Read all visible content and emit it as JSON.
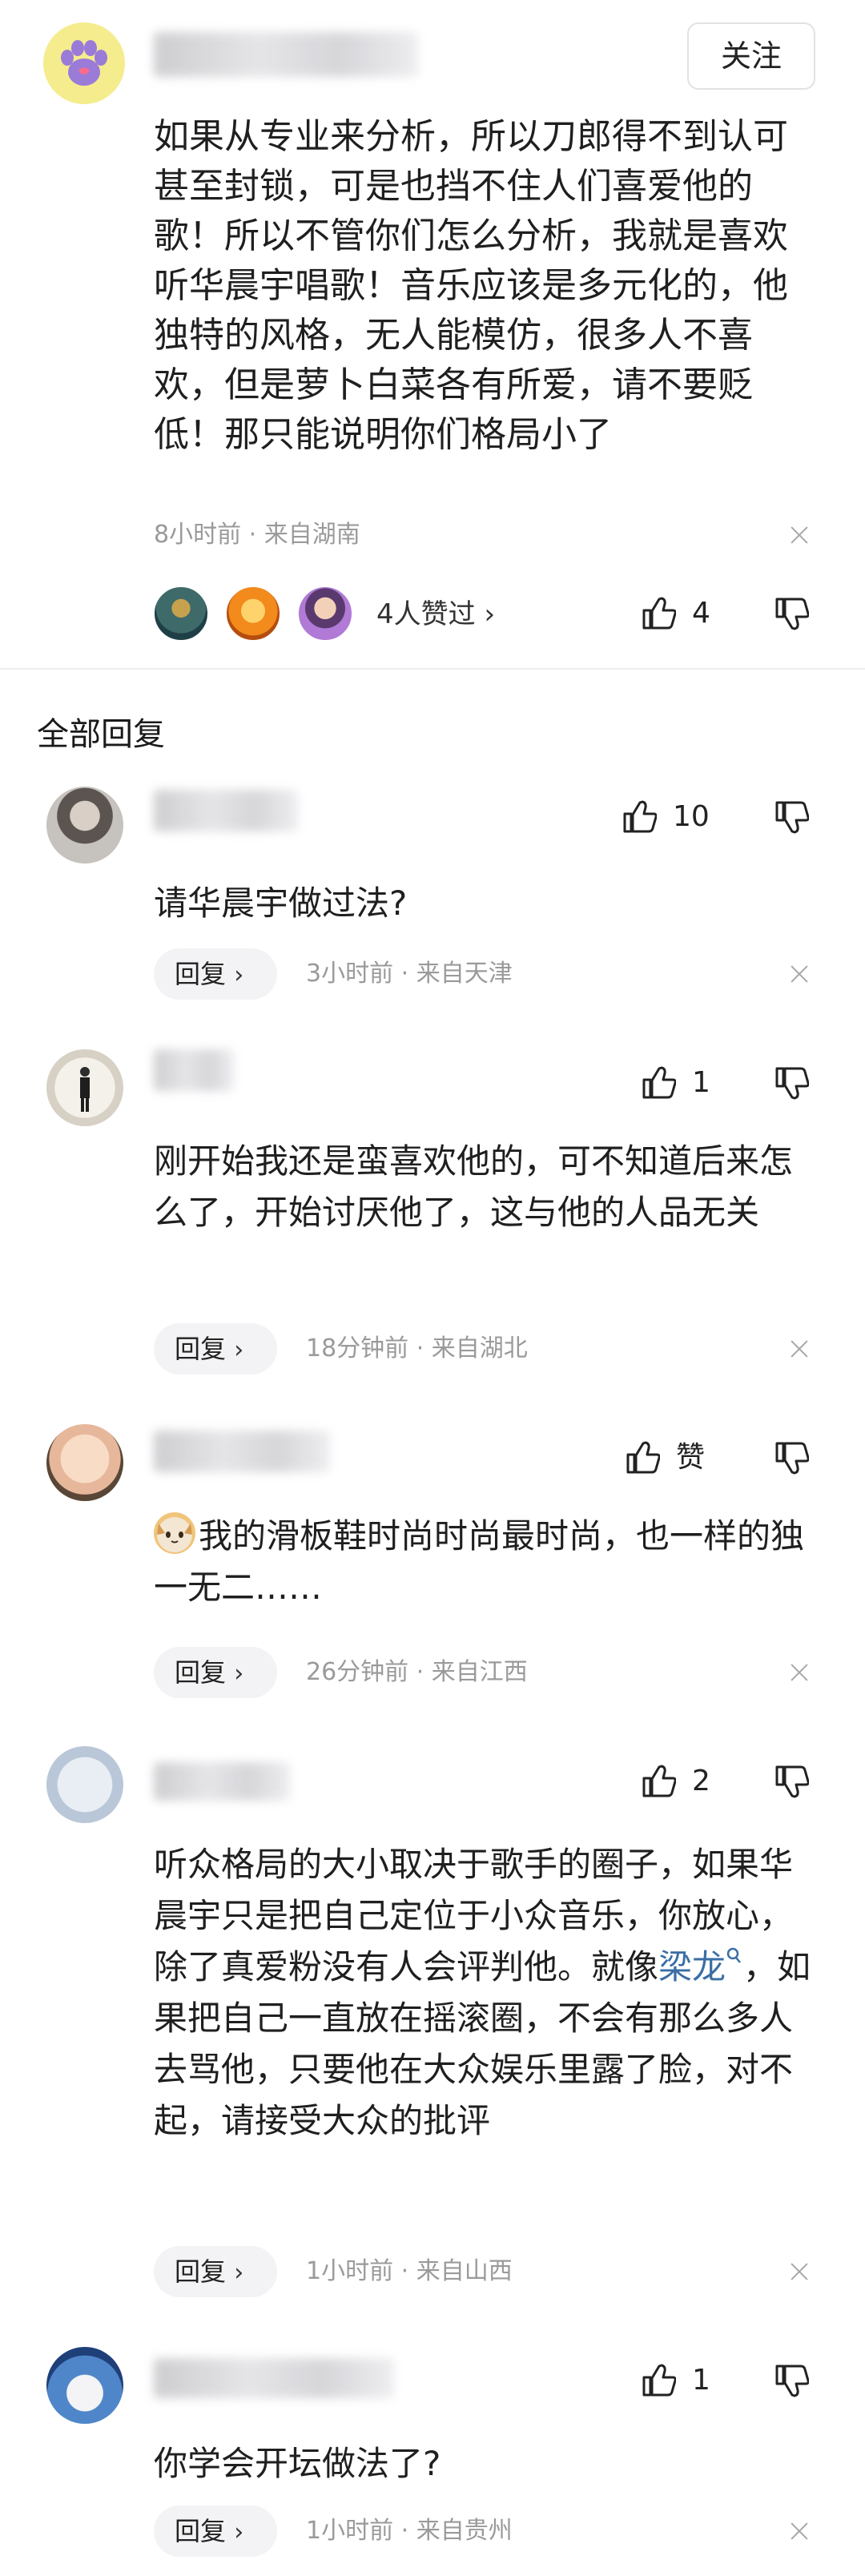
{
  "main_comment": {
    "follow_label": "关注",
    "text": "如果从专业来分析，所以刀郎得不到认可甚至封锁，可是也挡不住人们喜爱他的歌！所以不管你们怎么分析，我就是喜欢听华晨宇唱歌！音乐应该是多元化的，他独特的风格，无人能模仿，很多人不喜欢，但是萝卜白菜各有所爱，请不要贬低！那只能说明你们格局小了",
    "meta": "8小时前 · 来自湖南",
    "likers_label": "4人赞过",
    "likers_chevron": "›",
    "like_count": "4"
  },
  "section_title": "全部回复",
  "replies": [
    {
      "text": "请华晨宇做过法?",
      "meta": "3小时前 · 来自天津",
      "like_count": "10",
      "reply_label": "回复",
      "chevron": "›"
    },
    {
      "text": "刚开始我还是蛮喜欢他的，可不知道后来怎么了，开始讨厌他了，这与他的人品无关",
      "meta": "18分钟前 · 来自湖北",
      "like_count": "1",
      "reply_label": "回复",
      "chevron": "›"
    },
    {
      "text": "我的滑板鞋时尚时尚最时尚，也一样的独一无二……",
      "meta": "26分钟前 · 来自江西",
      "like_count": "赞",
      "reply_label": "回复",
      "chevron": "›"
    },
    {
      "text_before": "听众格局的大小取决于歌手的圈子，如果华晨宇只是把自己定位于小众音乐，你放心，除了真爱粉没有人会评判他。就像",
      "link": "梁龙",
      "text_after": "，如果把自己一直放在摇滚圈，不会有那么多人去骂他，只要他在大众娱乐里露了脸，对不起，请接受大众的批评",
      "meta": "1小时前 · 来自山西",
      "like_count": "2",
      "reply_label": "回复",
      "chevron": "›"
    },
    {
      "text": "你学会开坛做法了?",
      "meta": "1小时前 · 来自贵州",
      "like_count": "1",
      "reply_label": "回复",
      "chevron": "›"
    }
  ],
  "colors": {
    "link": "#3a6ea5",
    "meta": "#9a9a9a",
    "pill_bg": "#f3f3f5"
  },
  "icons": [
    "paw-avatar-icon",
    "thumb-up-icon",
    "thumb-down-icon",
    "close-icon",
    "cat-emoji-icon",
    "search-mini-icon"
  ]
}
